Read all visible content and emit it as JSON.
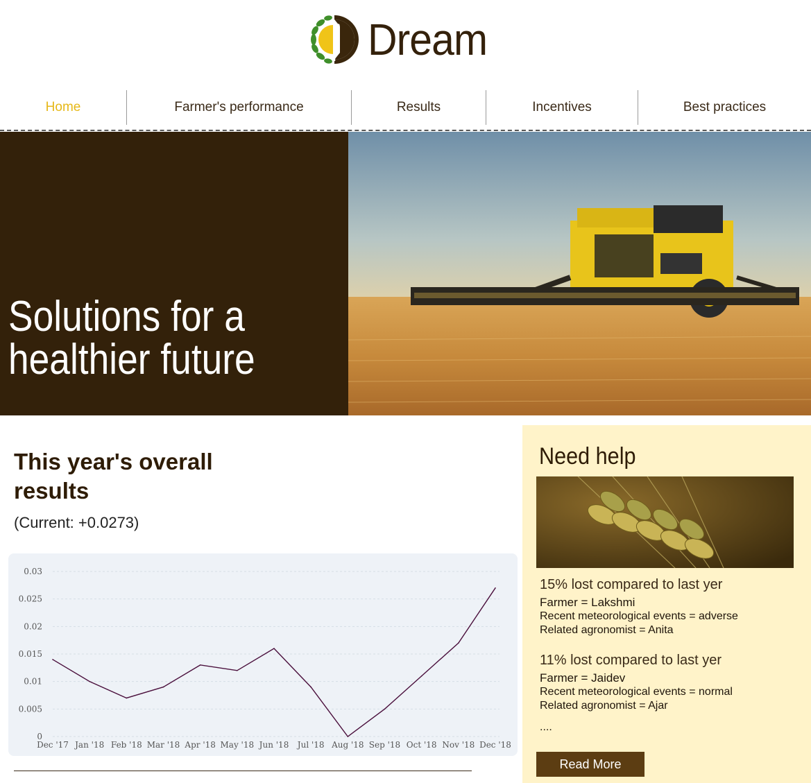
{
  "brand": {
    "name": "Dream"
  },
  "nav": {
    "items": [
      {
        "label": "Home",
        "active": true
      },
      {
        "label": "Farmer's performance",
        "active": false
      },
      {
        "label": "Results",
        "active": false
      },
      {
        "label": "Incentives",
        "active": false
      },
      {
        "label": "Best practices",
        "active": false
      }
    ]
  },
  "hero": {
    "title_line1": "Solutions for a",
    "title_line2": "healthier future"
  },
  "results": {
    "title": "This year's overall results",
    "current": "(Current: +0.0273)"
  },
  "chart_data": {
    "type": "line",
    "categories": [
      "Dec '17",
      "Jan '18",
      "Feb '18",
      "Mar '18",
      "Apr '18",
      "May '18",
      "Jun '18",
      "Jul '18",
      "Aug '18",
      "Sep '18",
      "Oct '18",
      "Nov '18",
      "Dec '18"
    ],
    "values": [
      0.014,
      0.01,
      0.007,
      0.009,
      0.013,
      0.012,
      0.016,
      0.009,
      0.0,
      0.005,
      0.011,
      0.017,
      0.027
    ],
    "yticks": [
      "0",
      "0.005",
      "0.01",
      "0.015",
      "0.02",
      "0.025",
      "0.03"
    ],
    "ylim": [
      0,
      0.03
    ],
    "line_color": "#4a0f3c",
    "grid": true
  },
  "help": {
    "title": "Need help",
    "cases": [
      {
        "headline": "15% lost compared to last yer",
        "farmer": "Farmer = Lakshmi",
        "events": "Recent meteorological events = adverse",
        "agronomist": "Related agronomist = Anita"
      },
      {
        "headline": "11% lost compared to last yer",
        "farmer": "Farmer = Jaidev",
        "events": "Recent meteorological events = normal",
        "agronomist": "Related agronomist = Ajar"
      }
    ],
    "more": "....",
    "read_more": "Read More"
  },
  "colors": {
    "brand_dark": "#33210a",
    "accent_yellow": "#e6b818",
    "help_bg": "#fff3c9",
    "button_bg": "#5c3d12"
  }
}
